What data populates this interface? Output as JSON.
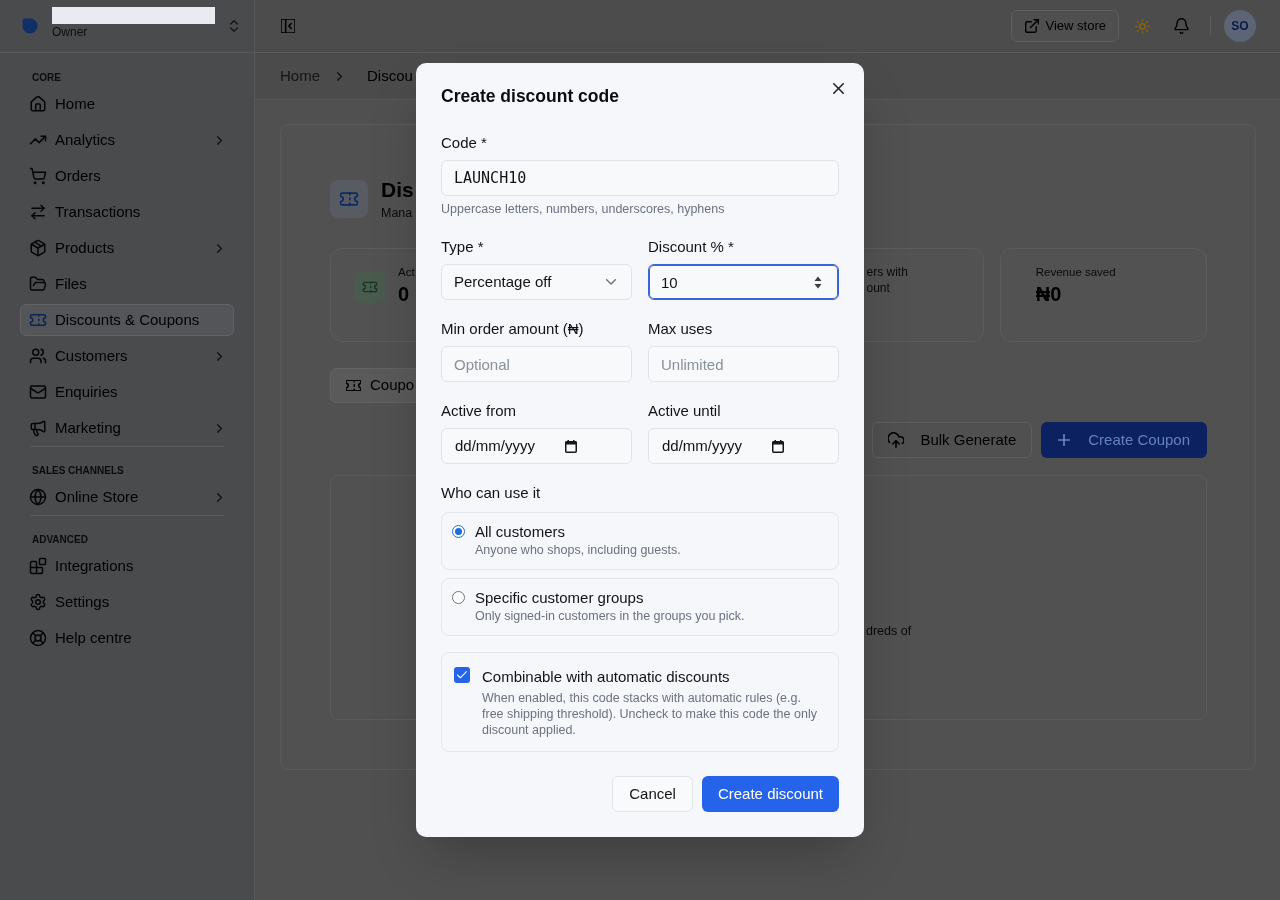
{
  "sidebar": {
    "role": "Owner",
    "sections": [
      {
        "title": "CORE",
        "items": [
          {
            "label": "Home",
            "selected": false,
            "has_submenu": false
          },
          {
            "label": "Analytics",
            "selected": false,
            "has_submenu": true
          },
          {
            "label": "Orders",
            "selected": false,
            "has_submenu": false
          },
          {
            "label": "Transactions",
            "selected": false,
            "has_submenu": false
          },
          {
            "label": "Products",
            "selected": false,
            "has_submenu": true
          },
          {
            "label": "Files",
            "selected": false,
            "has_submenu": false
          },
          {
            "label": "Discounts & Coupons",
            "selected": true,
            "has_submenu": false
          },
          {
            "label": "Customers",
            "selected": false,
            "has_submenu": true
          },
          {
            "label": "Enquiries",
            "selected": false,
            "has_submenu": false
          },
          {
            "label": "Marketing",
            "selected": false,
            "has_submenu": true
          }
        ]
      },
      {
        "title": "SALES CHANNELS",
        "items": [
          {
            "label": "Online Store",
            "selected": false,
            "has_submenu": true
          }
        ]
      },
      {
        "title": "ADVANCED",
        "items": [
          {
            "label": "Integrations",
            "selected": false,
            "has_submenu": false
          },
          {
            "label": "Settings",
            "selected": false,
            "has_submenu": false
          },
          {
            "label": "Help centre",
            "selected": false,
            "has_submenu": false
          }
        ]
      }
    ]
  },
  "topbar": {
    "view_store": "View store",
    "avatar_initials": "SO"
  },
  "breadcrumbs": [
    {
      "label": "Home",
      "current": false
    },
    {
      "label": "Discou",
      "current": true
    }
  ],
  "page": {
    "title": "Dis",
    "subtitle": "Mana",
    "stats": [
      {
        "kind": "icon_value",
        "label": "Act",
        "value": "0"
      },
      {
        "kind": "label_only",
        "label_lines": [
          "ers with",
          "ount"
        ]
      },
      {
        "kind": "icon_value",
        "label": "Revenue saved",
        "value": "₦0"
      }
    ],
    "tabs": [
      {
        "label": "Coupo",
        "selected": true
      }
    ],
    "actions": [
      {
        "label": "Bulk Generate",
        "kind": "secondary"
      },
      {
        "label": "Create Coupon",
        "kind": "primary"
      }
    ],
    "empty_state": {
      "text": "dreds of"
    }
  },
  "dialog": {
    "title": "Create discount code",
    "code": {
      "label": "Code *",
      "value": "LAUNCH10",
      "hint": "Uppercase letters, numbers, underscores, hyphens",
      "focused": false
    },
    "fields": [
      {
        "kind": "select",
        "label": "Type *",
        "value": "Percentage off",
        "focused": false
      },
      {
        "kind": "number",
        "label": "Discount % *",
        "value": "10",
        "focused": true
      },
      {
        "kind": "text",
        "label": "Min order amount (₦)",
        "placeholder": "Optional",
        "focused": false
      },
      {
        "kind": "text",
        "label": "Max uses",
        "placeholder": "Unlimited",
        "focused": false
      },
      {
        "kind": "date",
        "label": "Active from",
        "format": "dd/mm/yyyy",
        "focused": false
      },
      {
        "kind": "date",
        "label": "Active until",
        "format": "dd/mm/yyyy",
        "focused": false
      }
    ],
    "audience": {
      "label": "Who can use it",
      "options": [
        {
          "title": "All customers",
          "description": "Anyone who shops, including guests.",
          "selected": true
        },
        {
          "title": "Specific customer groups",
          "description": "Only signed-in customers in the groups you pick.",
          "selected": false
        }
      ]
    },
    "combinable": {
      "title": "Combinable with automatic discounts",
      "description": "When enabled, this code stacks with automatic rules (e.g. free shipping threshold). Uncheck to make this code the only discount applied.",
      "checked": true
    },
    "buttons": [
      {
        "label": "Cancel",
        "kind": "secondary"
      },
      {
        "label": "Create discount",
        "kind": "primary"
      }
    ]
  }
}
